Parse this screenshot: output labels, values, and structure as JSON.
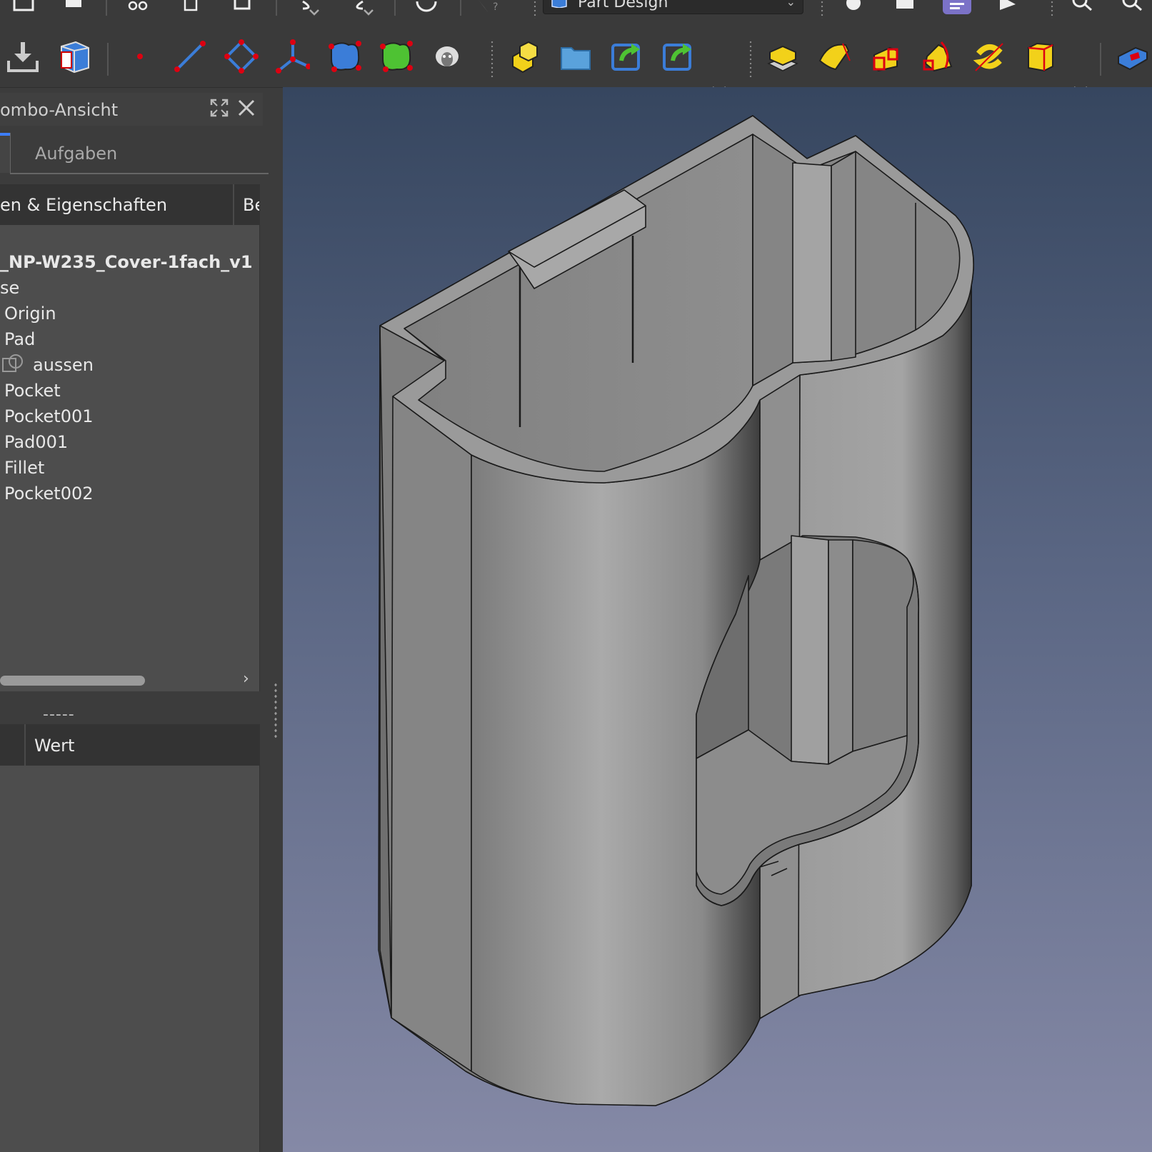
{
  "workbench": {
    "label": "Part Design"
  },
  "combo": {
    "title": "ombo-Ansicht"
  },
  "tabs": {
    "aufgaben": "Aufgaben"
  },
  "tree": {
    "header_label": "en & Eigenschaften",
    "header_label2": "Be",
    "document": "_NP-W235_Cover-1fach_v1",
    "body": "se",
    "items": [
      "Origin",
      "Pad",
      "aussen",
      "Pocket",
      "Pocket001",
      "Pad001",
      "Fillet",
      "Pocket002"
    ]
  },
  "splitter": {
    "dots": "-----"
  },
  "properties": {
    "value_header": "Wert"
  },
  "colors": {
    "tab_accent": "#3d7eff",
    "viewport_top": "#36465f",
    "viewport_bottom": "#8589a6"
  },
  "icons": [
    "save-icon",
    "print-icon",
    "cut-icon",
    "copy-icon",
    "paste-icon",
    "undo-icon",
    "redo-icon",
    "refresh-icon",
    "whats-this-icon",
    "macro-record-icon",
    "macro-stop-icon",
    "macro-edit-icon",
    "macro-run-icon",
    "zoom-icon",
    "import-icon",
    "part-icon",
    "point-icon",
    "line-icon",
    "plane-icon",
    "coord-system-icon",
    "shape-binder-icon",
    "subshape-binder-icon",
    "clone-icon",
    "body-icon",
    "folder-icon",
    "share-icon",
    "link-icon",
    "pad-icon",
    "revolution-icon",
    "additive-loft-icon",
    "additive-pipe-icon",
    "additive-helix-icon",
    "additive-box-icon",
    "pocket-icon"
  ]
}
